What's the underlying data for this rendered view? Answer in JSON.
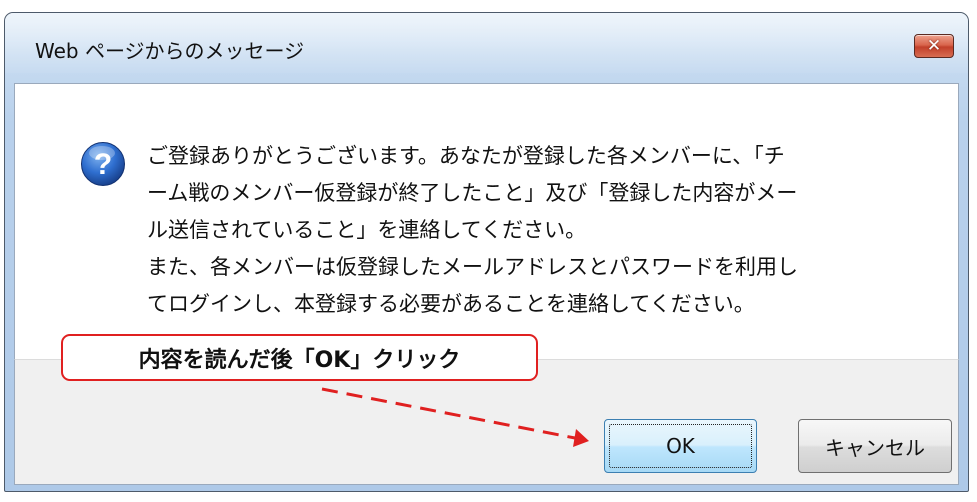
{
  "dialog": {
    "title": "Web ページからのメッセージ",
    "close_glyph": "✕",
    "icon": "question-icon",
    "message_lines": [
      "ご登録ありがとうございます。あなたが登録した各メンバーに、「チ",
      "ーム戦のメンバー仮登録が終了したこと」及び「登録した内容がメー",
      "ル送信されていること」を連絡してください。",
      "また、各メンバーは仮登録したメールアドレスとパスワードを利用し",
      "てログインし、本登録する必要があることを連絡してください。"
    ],
    "ok_label": "OK",
    "cancel_label": "キャンセル"
  },
  "annotation": {
    "callout_text": "内容を読んだ後「OK」クリック",
    "color": "#e02020"
  },
  "colors": {
    "title_bar": "#c8dcf1",
    "close_button": "#c94a33",
    "footer": "#f0f0f0",
    "ok_border": "#3c7fb1"
  }
}
